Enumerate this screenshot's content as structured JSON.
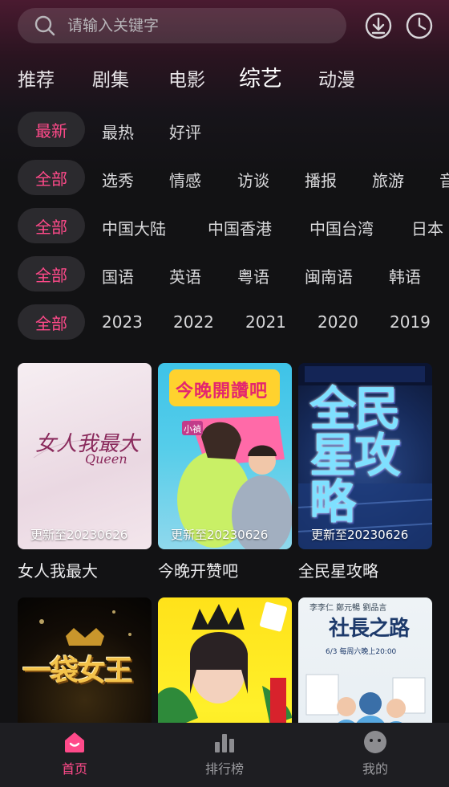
{
  "search": {
    "placeholder": "请输入关键字"
  },
  "category_nav": [
    "推荐",
    "剧集",
    "电影",
    "综艺",
    "动漫"
  ],
  "filters": {
    "sort": {
      "selected": "最新",
      "options": [
        "最热",
        "好评"
      ]
    },
    "type": {
      "selected": "全部",
      "options": [
        "选秀",
        "情感",
        "访谈",
        "播报",
        "旅游",
        "音"
      ]
    },
    "region": {
      "selected": "全部",
      "options": [
        "中国大陆",
        "中国香港",
        "中国台湾",
        "日本"
      ]
    },
    "language": {
      "selected": "全部",
      "options": [
        "国语",
        "英语",
        "粤语",
        "闽南语",
        "韩语"
      ]
    },
    "year": {
      "selected": "全部",
      "options": [
        "2023",
        "2022",
        "2021",
        "2020",
        "2019"
      ]
    }
  },
  "cards": [
    {
      "title": "女人我最大",
      "update": "更新至20230626",
      "poster_text": "女人我最大",
      "poster_sub": "Queen"
    },
    {
      "title": "今晚开赞吧",
      "update": "更新至20230626",
      "poster_text": "今晚開讚吧",
      "poster_sub": "小禎"
    },
    {
      "title": "全民星攻略",
      "update": "更新至20230626",
      "poster_text": "全民星攻略"
    },
    {
      "title": "",
      "update": "",
      "poster_text": "一袋女王"
    },
    {
      "title": "",
      "update": ""
    },
    {
      "title": "",
      "update": "",
      "poster_text": "社長之路",
      "poster_sub": "6/3 每周六晚上20:00",
      "poster_names": "李李仁  鄭元暢  劉品言"
    }
  ],
  "bottom_nav": [
    {
      "label": "首页",
      "icon": "home-icon",
      "active": true
    },
    {
      "label": "排行榜",
      "icon": "bar-chart-icon",
      "active": false
    },
    {
      "label": "我的",
      "icon": "profile-icon",
      "active": false
    }
  ],
  "colors": {
    "accent": "#ff4a8a",
    "background": "#121214",
    "chip_bg": "#2b2a2e",
    "header_tint": "#4a1a30"
  }
}
